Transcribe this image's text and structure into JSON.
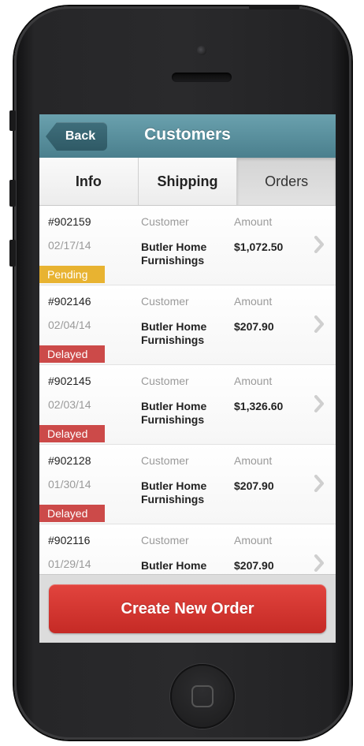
{
  "navbar": {
    "back_label": "Back",
    "title": "Customers"
  },
  "tabs": [
    {
      "label": "Info",
      "active": false
    },
    {
      "label": "Shipping",
      "active": false
    },
    {
      "label": "Orders",
      "active": true
    }
  ],
  "orders": {
    "customer_label": "Customer",
    "amount_label": "Amount",
    "rows": [
      {
        "id": "#902159",
        "date": "02/17/14",
        "customer": "Butler Home Furnishings",
        "amount": "$1,072.50",
        "status": "Pending"
      },
      {
        "id": "#902146",
        "date": "02/04/14",
        "customer": "Butler Home Furnishings",
        "amount": "$207.90",
        "status": "Delayed"
      },
      {
        "id": "#902145",
        "date": "02/03/14",
        "customer": "Butler Home Furnishings",
        "amount": "$1,326.60",
        "status": "Delayed"
      },
      {
        "id": "#902128",
        "date": "01/30/14",
        "customer": "Butler Home Furnishings",
        "amount": "$207.90",
        "status": "Delayed"
      },
      {
        "id": "#902116",
        "date": "01/29/14",
        "customer": "Butler Home Furnishings",
        "amount": "$207.90",
        "status": ""
      }
    ]
  },
  "footer": {
    "create_label": "Create New Order"
  },
  "colors": {
    "navbar": "#5a8f9d",
    "pending": "#e8b331",
    "delayed": "#cc4a49",
    "create_button": "#d6352f"
  },
  "icons": {
    "row_chevron": "chevron-right-icon",
    "home_button": "home-button-icon"
  }
}
